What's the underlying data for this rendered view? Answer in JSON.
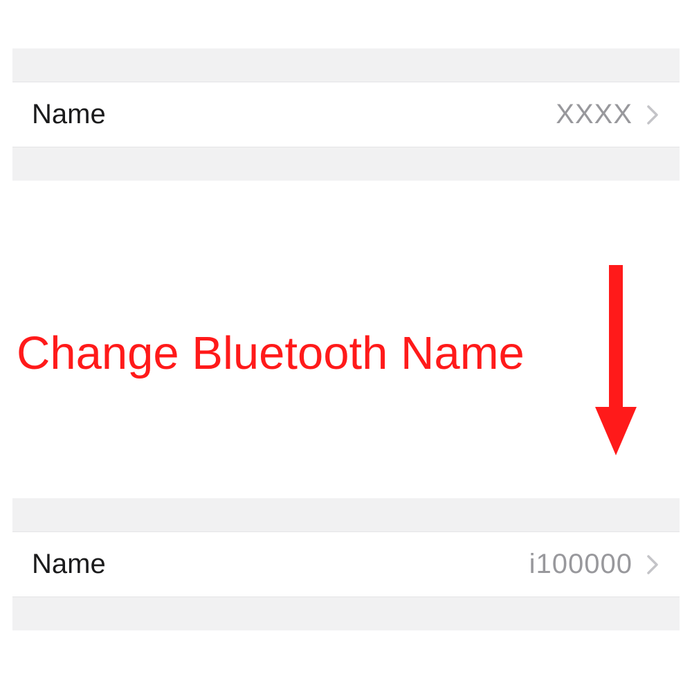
{
  "before": {
    "label": "Name",
    "value": "XXXX"
  },
  "after": {
    "label": "Name",
    "value": "i100000"
  },
  "annotation": {
    "caption": "Change Bluetooth Name",
    "color": "#ff1a1a"
  }
}
